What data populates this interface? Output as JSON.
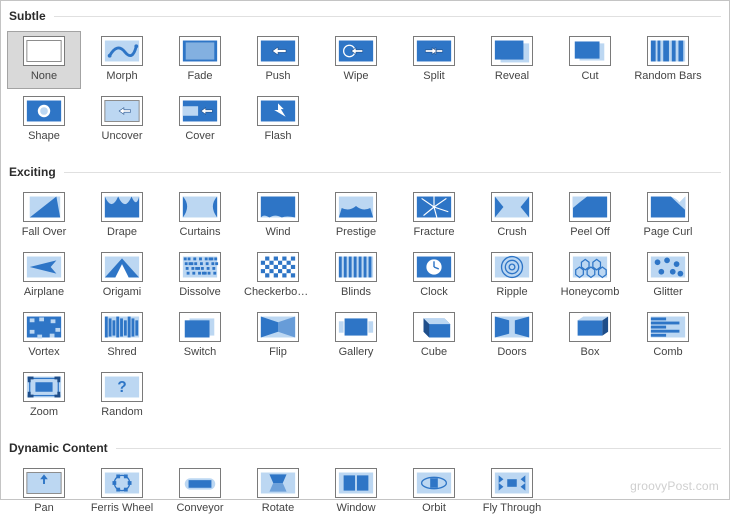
{
  "watermark": "groovyPost.com",
  "sections": [
    {
      "title": "Subtle",
      "items": [
        {
          "label": "None",
          "icon": "none",
          "selected": true
        },
        {
          "label": "Morph",
          "icon": "morph"
        },
        {
          "label": "Fade",
          "icon": "fade"
        },
        {
          "label": "Push",
          "icon": "push"
        },
        {
          "label": "Wipe",
          "icon": "wipe"
        },
        {
          "label": "Split",
          "icon": "split"
        },
        {
          "label": "Reveal",
          "icon": "reveal"
        },
        {
          "label": "Cut",
          "icon": "cut"
        },
        {
          "label": "Random Bars",
          "icon": "random-bars"
        },
        {
          "label": "Shape",
          "icon": "shape"
        },
        {
          "label": "Uncover",
          "icon": "uncover"
        },
        {
          "label": "Cover",
          "icon": "cover"
        },
        {
          "label": "Flash",
          "icon": "flash"
        }
      ]
    },
    {
      "title": "Exciting",
      "items": [
        {
          "label": "Fall Over",
          "icon": "fall-over"
        },
        {
          "label": "Drape",
          "icon": "drape"
        },
        {
          "label": "Curtains",
          "icon": "curtains"
        },
        {
          "label": "Wind",
          "icon": "wind"
        },
        {
          "label": "Prestige",
          "icon": "prestige"
        },
        {
          "label": "Fracture",
          "icon": "fracture"
        },
        {
          "label": "Crush",
          "icon": "crush"
        },
        {
          "label": "Peel Off",
          "icon": "peel-off"
        },
        {
          "label": "Page Curl",
          "icon": "page-curl"
        },
        {
          "label": "Airplane",
          "icon": "airplane"
        },
        {
          "label": "Origami",
          "icon": "origami"
        },
        {
          "label": "Dissolve",
          "icon": "dissolve"
        },
        {
          "label": "Checkerboa...",
          "icon": "checkerboard"
        },
        {
          "label": "Blinds",
          "icon": "blinds"
        },
        {
          "label": "Clock",
          "icon": "clock"
        },
        {
          "label": "Ripple",
          "icon": "ripple"
        },
        {
          "label": "Honeycomb",
          "icon": "honeycomb"
        },
        {
          "label": "Glitter",
          "icon": "glitter"
        },
        {
          "label": "Vortex",
          "icon": "vortex"
        },
        {
          "label": "Shred",
          "icon": "shred"
        },
        {
          "label": "Switch",
          "icon": "switch"
        },
        {
          "label": "Flip",
          "icon": "flip"
        },
        {
          "label": "Gallery",
          "icon": "gallery"
        },
        {
          "label": "Cube",
          "icon": "cube"
        },
        {
          "label": "Doors",
          "icon": "doors"
        },
        {
          "label": "Box",
          "icon": "box"
        },
        {
          "label": "Comb",
          "icon": "comb"
        },
        {
          "label": "Zoom",
          "icon": "zoom"
        },
        {
          "label": "Random",
          "icon": "random"
        }
      ]
    },
    {
      "title": "Dynamic Content",
      "items": [
        {
          "label": "Pan",
          "icon": "pan"
        },
        {
          "label": "Ferris Wheel",
          "icon": "ferris-wheel"
        },
        {
          "label": "Conveyor",
          "icon": "conveyor"
        },
        {
          "label": "Rotate",
          "icon": "rotate"
        },
        {
          "label": "Window",
          "icon": "window"
        },
        {
          "label": "Orbit",
          "icon": "orbit"
        },
        {
          "label": "Fly Through",
          "icon": "fly-through"
        }
      ]
    }
  ]
}
